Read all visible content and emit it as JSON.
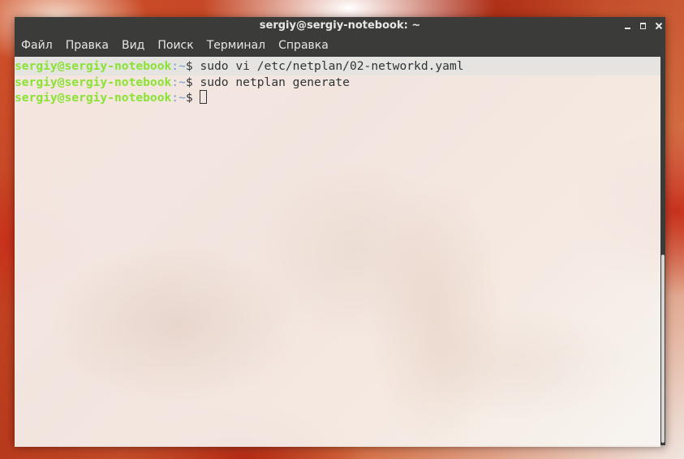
{
  "window": {
    "title": "sergiy@sergiy-notebook: ~"
  },
  "menu": {
    "items": [
      {
        "label": "Файл"
      },
      {
        "label": "Правка"
      },
      {
        "label": "Вид"
      },
      {
        "label": "Поиск"
      },
      {
        "label": "Терминал"
      },
      {
        "label": "Справка"
      }
    ]
  },
  "terminal": {
    "prompt_user": "sergiy@sergiy-notebook",
    "prompt_path": ":~",
    "prompt_symbol": "$ ",
    "lines": [
      {
        "command": "sudo vi /etc/netplan/02-networkd.yaml"
      },
      {
        "command": "sudo netplan generate"
      },
      {
        "command": ""
      }
    ]
  },
  "colors": {
    "prompt_user": "#8ae234",
    "prompt_path": "#729fcf",
    "text": "#2e3436",
    "titlebar": "#3b3b39"
  },
  "icons": {
    "minimize": "minimize-icon",
    "maximize": "maximize-icon",
    "close": "close-icon"
  }
}
